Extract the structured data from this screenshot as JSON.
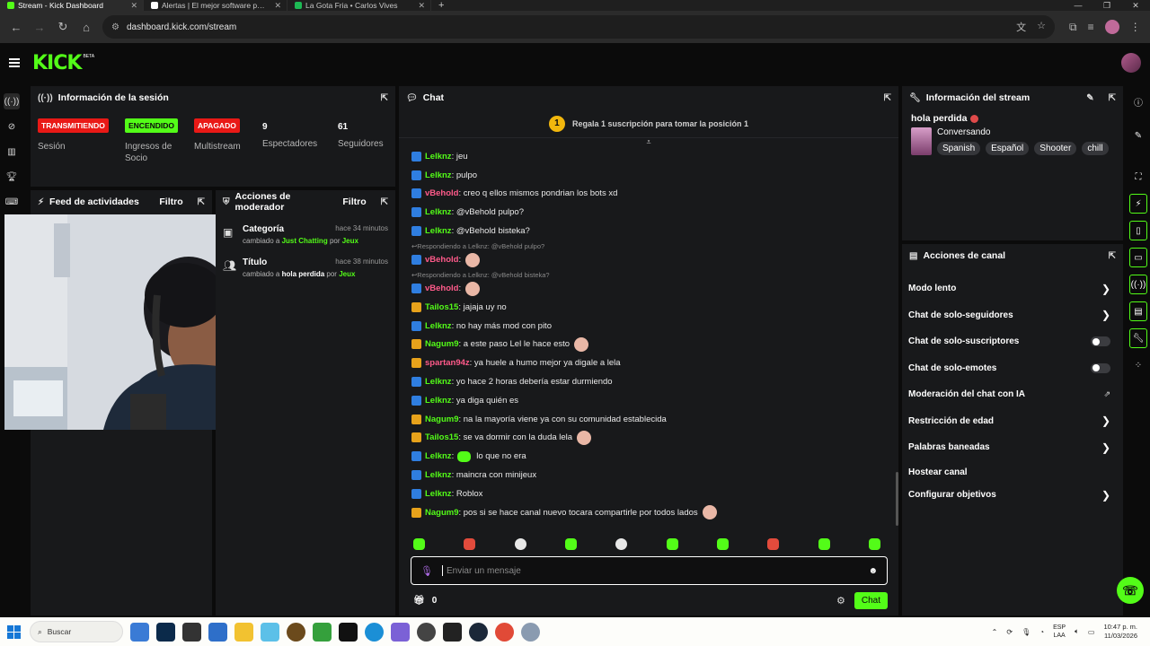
{
  "browser": {
    "tabs": [
      {
        "title": "Stream - Kick Dashboard",
        "active": true,
        "color": "#53fc18"
      },
      {
        "title": "Alertas | El mejor software para",
        "active": false,
        "color": "#ffffff"
      },
      {
        "title": "La Gota Fria • Carlos Vives",
        "active": false,
        "color": "#1db954"
      }
    ],
    "url": "dashboard.kick.com/stream"
  },
  "header": {
    "logo": "KICK",
    "beta": "BETA"
  },
  "session": {
    "title": "Información de la sesión",
    "columns": [
      {
        "badge": "TRANSMITIENDO",
        "badge_color": "red",
        "label": "Sesión"
      },
      {
        "badge": "ENCENDIDO",
        "badge_color": "green",
        "label": "Ingresos de Socio"
      },
      {
        "badge": "APAGADO",
        "badge_color": "red",
        "label": "Multistream"
      },
      {
        "value": "9",
        "label": "Espectadores"
      },
      {
        "value": "61",
        "label": "Seguidores"
      }
    ]
  },
  "feed": {
    "title": "Feed de actividades",
    "filter": "Filtro"
  },
  "mod": {
    "title": "Acciones de moderador",
    "filter": "Filtro",
    "items": [
      {
        "title": "Categoría",
        "time": "hace 34 minutos",
        "prefix": "cambiado a",
        "value": "Just Chatting",
        "by": "por",
        "user": "Jeux"
      },
      {
        "title": "Título",
        "time": "hace 38 minutos",
        "prefix": "cambiado a",
        "value": "hola perdida",
        "by": "por",
        "user": "Jeux"
      }
    ]
  },
  "chat": {
    "title": "Chat",
    "gift_text": "Regala 1 suscripción para tomar la posición 1",
    "gift_rank": "1",
    "messages": [
      {
        "badge": "mod",
        "user": "Lelknz",
        "color": "#53fc18",
        "text": ": jeu"
      },
      {
        "badge": "mod",
        "user": "Lelknz",
        "color": "#53fc18",
        "text": ": pulpo"
      },
      {
        "badge": "mod",
        "user": "vBehold",
        "color": "#ff5a8a",
        "text": ": creo q ellos mismos pondrian los bots xd"
      },
      {
        "badge": "mod",
        "user": "Lelknz",
        "color": "#53fc18",
        "text": ": @vBehold pulpo?"
      },
      {
        "badge": "mod",
        "user": "Lelknz",
        "color": "#53fc18",
        "text": ": @vBehold bisteka?"
      },
      {
        "reply": "Respondiendo a Lelknz: @vBehold pulpo?",
        "badge": "mod",
        "user": "vBehold",
        "color": "#ff5a8a",
        "text": ":",
        "emote": true
      },
      {
        "reply": "Respondiendo a Lelknz: @vBehold bisteka?",
        "badge": "mod",
        "user": "vBehold",
        "color": "#ff5a8a",
        "text": ":",
        "emote": true
      },
      {
        "badge": "sub",
        "user": "Tailos15",
        "color": "#53fc18",
        "text": ": jajaja uy no"
      },
      {
        "badge": "mod",
        "user": "Lelknz",
        "color": "#53fc18",
        "text": ": no hay más mod con pito"
      },
      {
        "badge": "sub",
        "user": "Nagum9",
        "color": "#53fc18",
        "text": ": a este paso Lel le hace esto",
        "emote": true
      },
      {
        "badge": "sub",
        "user": "spartan94z",
        "color": "#ff5a8a",
        "text": ": ya huele a humo mejor ya digale a lela"
      },
      {
        "badge": "mod",
        "user": "Lelknz",
        "color": "#53fc18",
        "text": ": yo hace 2 horas debería estar durmiendo"
      },
      {
        "badge": "mod",
        "user": "Lelknz",
        "color": "#53fc18",
        "text": ": ya diga quién es"
      },
      {
        "badge": "sub",
        "user": "Nagum9",
        "color": "#53fc18",
        "text": ": na la mayoría viene ya con su comunidad establecida"
      },
      {
        "badge": "sub",
        "user": "Tailos15",
        "color": "#53fc18",
        "text": ": se va dormir con la duda lela",
        "emote": true
      },
      {
        "badge": "mod",
        "user": "Lelknz",
        "color": "#53fc18",
        "text": ": ",
        "green_emote": true,
        "after": "lo que no era"
      },
      {
        "badge": "mod",
        "user": "Lelknz",
        "color": "#53fc18",
        "text": ": maincra con minijeux"
      },
      {
        "badge": "mod",
        "user": "Lelknz",
        "color": "#53fc18",
        "text": ": Roblox"
      },
      {
        "badge": "sub",
        "user": "Nagum9",
        "color": "#53fc18",
        "text": ": pos si se hace canal nuevo tocara compartirle por todos lados",
        "emote": true
      }
    ],
    "input_placeholder": "Enviar un mensaje",
    "points": "0",
    "send_label": "Chat"
  },
  "stream_info": {
    "title": "Información del stream",
    "stream_title": "hola perdida",
    "category": "Conversando",
    "tags": [
      "Spanish",
      "Español",
      "Shooter",
      "chill"
    ]
  },
  "channel_actions": {
    "title": "Acciones de canal",
    "items": [
      {
        "label": "Modo lento",
        "control": "chevron"
      },
      {
        "label": "Chat de solo-seguidores",
        "control": "chevron"
      },
      {
        "label": "Chat de solo-suscriptores",
        "control": "toggle"
      },
      {
        "label": "Chat de solo-emotes",
        "control": "toggle"
      },
      {
        "label": "Moderación del chat con IA",
        "control": "external"
      },
      {
        "label": "Restricción de edad",
        "control": "chevron"
      },
      {
        "label": "Palabras baneadas",
        "control": "chevron"
      },
      {
        "label": "Hostear canal",
        "control": "none"
      },
      {
        "label": "Configurar objetivos",
        "control": "chevron"
      }
    ]
  },
  "taskbar": {
    "search": "Buscar",
    "lang1": "ESP",
    "lang2": "LAA",
    "time": "10:47 p. m.",
    "date": "11/03/2026"
  }
}
